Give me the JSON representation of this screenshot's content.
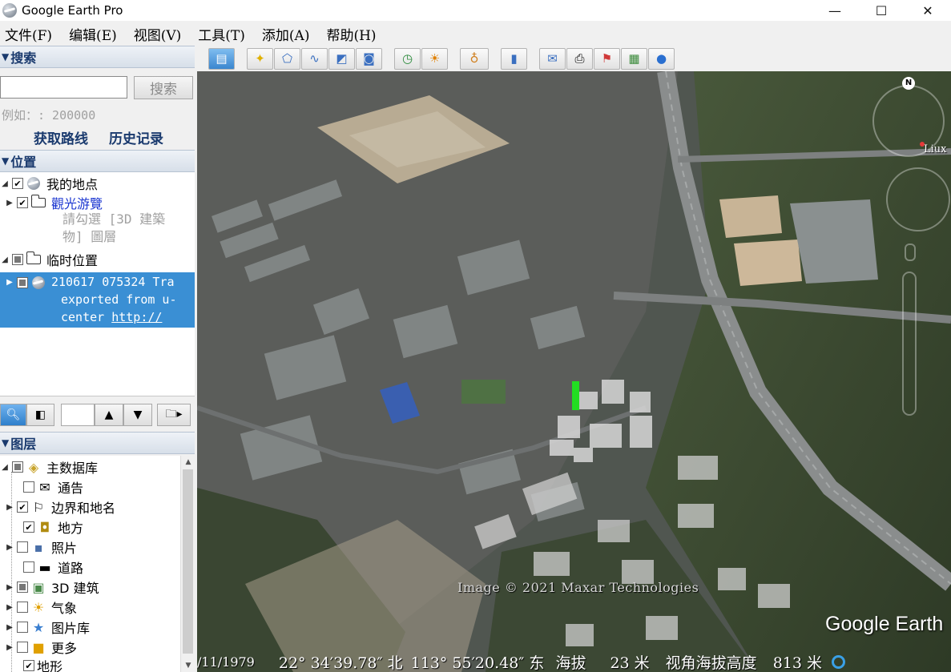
{
  "window": {
    "title": "Google Earth Pro",
    "minimize_glyph": "—",
    "maximize_glyph": "☐",
    "close_glyph": "✕"
  },
  "menu": [
    "文件(F)",
    "编辑(E)",
    "视图(V)",
    "工具(T)",
    "添加(A)",
    "帮助(H)"
  ],
  "search": {
    "header": "搜索",
    "input_value": "",
    "button_label": "搜索",
    "hint": "例如：: 200000",
    "links": [
      "获取路线",
      "历史记录"
    ]
  },
  "places": {
    "header": "位置",
    "my_places": "我的地点",
    "sightseeing": "觀光游覽",
    "sightseeing_note_line1": "請勾選 [3D 建築",
    "sightseeing_note_line2": "物] 圖層",
    "temp_places": "临时位置",
    "track_line1": "210617 075324 Tra",
    "track_line2": "exported from u-",
    "track_line3_prefix": "center ",
    "track_link": "http://"
  },
  "layers": {
    "header": "图层",
    "items": [
      {
        "label": "主数据库",
        "icon": "layers-stack-icon",
        "checked": "partial"
      },
      {
        "label": "通告",
        "icon": "envelope-icon",
        "checked": "none"
      },
      {
        "label": "边界和地名",
        "icon": "flag-icon",
        "checked": "checked"
      },
      {
        "label": "地方",
        "icon": "place-square-icon",
        "checked": "checked"
      },
      {
        "label": "照片",
        "icon": "photo-icon",
        "checked": "none"
      },
      {
        "label": "道路",
        "icon": "road-icon",
        "checked": "none"
      },
      {
        "label": "3D 建筑",
        "icon": "building-3d-icon",
        "checked": "partial"
      },
      {
        "label": "气象",
        "icon": "sun-icon",
        "checked": "none"
      },
      {
        "label": "图片库",
        "icon": "star-icon",
        "checked": "none"
      },
      {
        "label": "更多",
        "icon": "sticky-note-icon",
        "checked": "none"
      },
      {
        "label": "地形",
        "icon": "",
        "checked": "checked"
      }
    ]
  },
  "map": {
    "copyright": "Image © 2021 Maxar Technologies",
    "brand": "Google Earth",
    "north_label": "N",
    "place_label": "Liux",
    "status": {
      "date": "/11/1979",
      "lat": "22° 34′39.78″ 北",
      "lon": "113° 55′20.48″ 东",
      "elev_label": "海拔",
      "elev_value": "23 米",
      "eye_label": "视角海拔高度",
      "eye_value": "813 米"
    }
  },
  "colors": {
    "selection": "#3a8fd4",
    "link": "#1a35d0",
    "panel_header_text": "#1a3a6e"
  }
}
